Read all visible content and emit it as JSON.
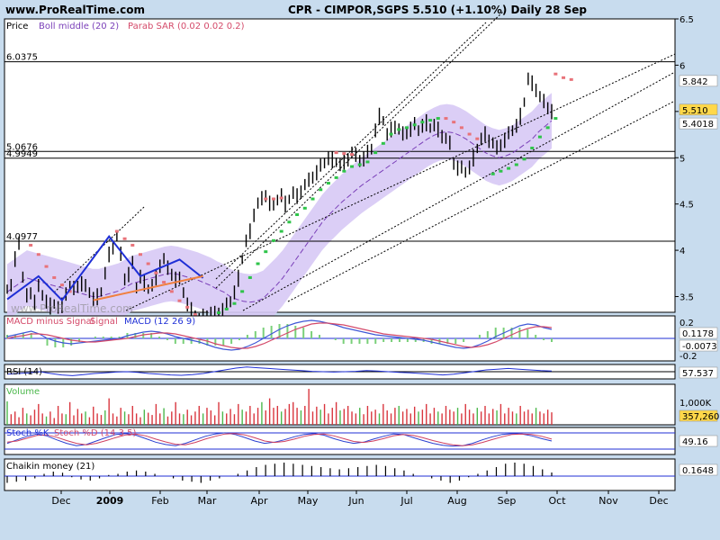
{
  "header": {
    "site": "www.ProRealTime.com",
    "title": "CPR - CIMPOR,SGPS   5.510 (+1.10%)   Daily  28 Sep"
  },
  "watermark": "www.ProRealTime.com",
  "colors": {
    "background": "#c8dcee",
    "panel": "#ffffff",
    "price": "#000000",
    "boll_band": "#d7c9f5",
    "boll_mid": "#7a3fb8",
    "sar_up": "#2fc44a",
    "sar_down": "#e8737a",
    "trend_blue": "#1f2fd6",
    "trend_orange": "#f08040",
    "macd": "#3f58d6",
    "signal": "#d44a6a",
    "volume": "#d9363e",
    "volume_up": "#4cb84c",
    "stoch_k": "#2b3fd0",
    "stoch_d": "#d04060",
    "chaikin": "#000000",
    "hline": "#000000",
    "price_box": "#ffd84a"
  },
  "chart_data": [
    {
      "panel": "price",
      "type": "line",
      "legend": [
        "Price",
        "Boll middle (20 2)",
        "Parab SAR (0.02 0.02 0.2)"
      ],
      "x_labels": [
        "Dec",
        "2009",
        "Feb",
        "Mar",
        "Apr",
        "May",
        "Jun",
        "Jul",
        "Aug",
        "Sep",
        "Oct",
        "Nov",
        "Dec"
      ],
      "y_ticks": [
        3.5,
        4,
        4.5,
        5,
        5.5,
        6,
        6.5
      ],
      "ylim": [
        3.33,
        6.5
      ],
      "h_levels": [
        {
          "value": 6.0375,
          "label": "6.0375"
        },
        {
          "value": 5.0676,
          "label": "5.0676"
        },
        {
          "value": 4.9949,
          "label": "4.9949"
        },
        {
          "value": 4.0977,
          "label": "4.0977"
        }
      ],
      "last_values": {
        "sar": "5.842",
        "price": "5.510",
        "boll_mid": "5.4018"
      },
      "close": [
        3.58,
        3.62,
        3.9,
        4.1,
        3.7,
        3.5,
        3.55,
        3.45,
        3.6,
        3.52,
        3.45,
        3.4,
        3.42,
        3.38,
        3.4,
        3.55,
        3.6,
        3.58,
        3.62,
        3.65,
        3.6,
        3.55,
        3.48,
        3.5,
        3.55,
        3.75,
        3.95,
        4.05,
        4.15,
        3.95,
        3.7,
        3.75,
        3.85,
        3.6,
        3.72,
        3.65,
        3.58,
        3.62,
        3.7,
        3.85,
        3.9,
        3.8,
        3.75,
        3.7,
        3.68,
        3.55,
        3.42,
        3.35,
        3.3,
        3.25,
        3.28,
        3.3,
        3.32,
        3.31,
        3.33,
        3.36,
        3.4,
        3.45,
        3.55,
        3.7,
        3.9,
        4.1,
        4.2,
        4.4,
        4.5,
        4.55,
        4.6,
        4.52,
        4.48,
        4.55,
        4.6,
        4.5,
        4.55,
        4.62,
        4.58,
        4.65,
        4.7,
        4.75,
        4.8,
        4.85,
        4.9,
        4.95,
        5.0,
        4.98,
        4.95,
        4.92,
        4.95,
        5.0,
        5.05,
        5.02,
        4.98,
        5.0,
        5.05,
        5.1,
        5.3,
        5.45,
        5.4,
        5.25,
        5.3,
        5.35,
        5.3,
        5.25,
        5.28,
        5.32,
        5.35,
        5.3,
        5.35,
        5.38,
        5.32,
        5.35,
        5.3,
        5.25,
        5.2,
        5.15,
        4.95,
        4.9,
        4.88,
        4.85,
        4.9,
        5.0,
        5.1,
        5.2,
        5.25,
        5.2,
        5.15,
        5.1,
        5.15,
        5.2,
        5.25,
        5.3,
        5.35,
        5.45,
        5.6,
        5.85,
        5.8,
        5.75,
        5.65,
        5.6,
        5.55,
        5.51
      ],
      "boll_mid": [
        3.55,
        3.6,
        3.65,
        3.7,
        3.68,
        3.66,
        3.64,
        3.62,
        3.6,
        3.58,
        3.56,
        3.54,
        3.52,
        3.5,
        3.5,
        3.52,
        3.54,
        3.56,
        3.6,
        3.64,
        3.66,
        3.68,
        3.7,
        3.72,
        3.74,
        3.75,
        3.74,
        3.72,
        3.7,
        3.68,
        3.65,
        3.62,
        3.58,
        3.55,
        3.5,
        3.47,
        3.45,
        3.44,
        3.45,
        3.48,
        3.55,
        3.62,
        3.7,
        3.8,
        3.9,
        4.0,
        4.1,
        4.2,
        4.3,
        4.38,
        4.45,
        4.52,
        4.58,
        4.64,
        4.7,
        4.75,
        4.8,
        4.85,
        4.9,
        4.95,
        5.0,
        5.05,
        5.1,
        5.15,
        5.2,
        5.24,
        5.27,
        5.28,
        5.27,
        5.24,
        5.2,
        5.15,
        5.1,
        5.05,
        5.02,
        5.0,
        5.02,
        5.05,
        5.1,
        5.15,
        5.2,
        5.28,
        5.34,
        5.4
      ],
      "sar_up": [
        [
          54,
          3.32
        ],
        [
          56,
          3.36
        ],
        [
          58,
          3.42
        ],
        [
          60,
          3.55
        ],
        [
          62,
          3.7
        ],
        [
          64,
          3.85
        ],
        [
          66,
          3.98
        ],
        [
          68,
          4.1
        ],
        [
          70,
          4.2
        ],
        [
          72,
          4.3
        ],
        [
          74,
          4.38
        ],
        [
          76,
          4.45
        ],
        [
          78,
          4.55
        ],
        [
          80,
          4.65
        ],
        [
          82,
          4.72
        ],
        [
          84,
          4.78
        ],
        [
          86,
          4.85
        ],
        [
          88,
          4.9
        ],
        [
          90,
          4.92
        ],
        [
          92,
          4.95
        ],
        [
          94,
          5.05
        ],
        [
          96,
          5.15
        ],
        [
          98,
          5.25
        ],
        [
          100,
          5.3
        ],
        [
          102,
          5.32
        ],
        [
          104,
          5.35
        ],
        [
          106,
          5.38
        ],
        [
          108,
          5.4
        ],
        [
          110,
          5.42
        ],
        [
          124,
          4.82
        ],
        [
          126,
          4.85
        ],
        [
          128,
          4.88
        ],
        [
          130,
          4.92
        ],
        [
          132,
          4.98
        ],
        [
          134,
          5.1
        ],
        [
          136,
          5.22
        ],
        [
          138,
          5.32
        ],
        [
          140,
          5.42
        ]
      ],
      "sar_down": [
        [
          6,
          4.05
        ],
        [
          8,
          3.95
        ],
        [
          10,
          3.82
        ],
        [
          12,
          3.7
        ],
        [
          14,
          3.62
        ],
        [
          16,
          3.55
        ],
        [
          28,
          4.2
        ],
        [
          30,
          4.12
        ],
        [
          32,
          4.05
        ],
        [
          34,
          3.95
        ],
        [
          36,
          3.85
        ],
        [
          38,
          3.75
        ],
        [
          40,
          3.65
        ],
        [
          42,
          3.55
        ],
        [
          44,
          3.45
        ],
        [
          46,
          3.38
        ],
        [
          48,
          3.3
        ],
        [
          66,
          4.55
        ],
        [
          68,
          4.55
        ],
        [
          70,
          4.56
        ],
        [
          84,
          5.05
        ],
        [
          86,
          5.04
        ],
        [
          88,
          5.03
        ],
        [
          112,
          5.42
        ],
        [
          114,
          5.38
        ],
        [
          116,
          5.32
        ],
        [
          118,
          5.25
        ],
        [
          120,
          5.2
        ],
        [
          140,
          5.9
        ],
        [
          142,
          5.86
        ],
        [
          144,
          5.84
        ]
      ],
      "trend_blue": [
        [
          0,
          3.47
        ],
        [
          8,
          3.72
        ],
        [
          14,
          3.46
        ],
        [
          26,
          4.15
        ],
        [
          34,
          3.72
        ],
        [
          44,
          3.9
        ],
        [
          50,
          3.7
        ]
      ],
      "trend_orange": [
        [
          22,
          3.46
        ],
        [
          50,
          3.72
        ]
      ]
    },
    {
      "panel": "macd",
      "type": "line",
      "legend": [
        "MACD minus Signal",
        "Signal",
        "MACD (12 26 9)"
      ],
      "y_ticks": [
        0.2,
        0,
        -0.2
      ],
      "last_values": {
        "macd": "0.1178",
        "signal": "-0.0073"
      },
      "macd": [
        0.02,
        0.04,
        0.06,
        0.08,
        0.05,
        0.0,
        -0.03,
        -0.05,
        -0.06,
        -0.05,
        -0.04,
        -0.03,
        -0.02,
        -0.01,
        0.0,
        0.03,
        0.05,
        0.07,
        0.08,
        0.07,
        0.05,
        0.02,
        0.0,
        -0.02,
        -0.04,
        -0.07,
        -0.1,
        -0.12,
        -0.13,
        -0.12,
        -0.09,
        -0.05,
        0.0,
        0.05,
        0.1,
        0.14,
        0.17,
        0.19,
        0.2,
        0.19,
        0.17,
        0.15,
        0.12,
        0.1,
        0.08,
        0.06,
        0.04,
        0.03,
        0.02,
        0.01,
        0.0,
        -0.01,
        -0.02,
        -0.04,
        -0.06,
        -0.08,
        -0.1,
        -0.11,
        -0.1,
        -0.07,
        -0.03,
        0.02,
        0.06,
        0.1,
        0.14,
        0.16,
        0.15,
        0.12,
        0.1
      ],
      "signal": [
        0.0,
        0.02,
        0.03,
        0.05,
        0.05,
        0.04,
        0.02,
        0.0,
        -0.02,
        -0.03,
        -0.04,
        -0.04,
        -0.03,
        -0.02,
        -0.01,
        0.0,
        0.02,
        0.04,
        0.05,
        0.06,
        0.06,
        0.05,
        0.03,
        0.01,
        -0.01,
        -0.03,
        -0.06,
        -0.08,
        -0.1,
        -0.11,
        -0.11,
        -0.09,
        -0.06,
        -0.02,
        0.02,
        0.06,
        0.1,
        0.13,
        0.16,
        0.17,
        0.17,
        0.16,
        0.15,
        0.13,
        0.11,
        0.09,
        0.07,
        0.05,
        0.04,
        0.03,
        0.02,
        0.01,
        0.0,
        -0.01,
        -0.03,
        -0.05,
        -0.07,
        -0.09,
        -0.1,
        -0.09,
        -0.07,
        -0.04,
        0.0,
        0.04,
        0.08,
        0.11,
        0.13,
        0.13,
        0.12
      ]
    },
    {
      "panel": "rsi",
      "type": "line",
      "legend": [
        "RSI (14)"
      ],
      "last_value": "57.537",
      "values": [
        48,
        50,
        52,
        55,
        50,
        46,
        44,
        47,
        50,
        52,
        54,
        55,
        53,
        50,
        48,
        46,
        45,
        47,
        50,
        55,
        60,
        65,
        68,
        66,
        64,
        62,
        60,
        58,
        56,
        55,
        54,
        55,
        56,
        58,
        57,
        55,
        53,
        52,
        50,
        48,
        46,
        48,
        52,
        56,
        60,
        62,
        64,
        62,
        60,
        58,
        57
      ]
    },
    {
      "panel": "volume",
      "type": "bar",
      "legend": [
        "Volume"
      ],
      "y_ticks": [
        "1,000K"
      ],
      "last_value": "357,260",
      "values": [
        0.62,
        0.28,
        0.35,
        0.2,
        0.45,
        0.3,
        0.25,
        0.4,
        0.55,
        0.3,
        0.22,
        0.35,
        0.18,
        0.5,
        0.3,
        0.28,
        0.6,
        0.25,
        0.42,
        0.3,
        0.35,
        0.2,
        0.48,
        0.3,
        0.26,
        0.38,
        0.7,
        0.3,
        0.22,
        0.45,
        0.35,
        0.28,
        0.5,
        0.3,
        0.2,
        0.4,
        0.32,
        0.26,
        0.55,
        0.3,
        0.44,
        0.22,
        0.35,
        0.6,
        0.3,
        0.28,
        0.4,
        0.25,
        0.35,
        0.5,
        0.3,
        0.45,
        0.38,
        0.25,
        0.6,
        0.35,
        0.3,
        0.42,
        0.28,
        0.55,
        0.4,
        0.35,
        0.5,
        0.3,
        0.45,
        0.6,
        0.38,
        0.7,
        0.45,
        0.5,
        0.35,
        0.42,
        0.55,
        0.6,
        0.45,
        0.38,
        0.5,
        0.95,
        0.35,
        0.48,
        0.4,
        0.55,
        0.3,
        0.45,
        0.6,
        0.38,
        0.42,
        0.5,
        0.35,
        0.3,
        0.45,
        0.28,
        0.5,
        0.35,
        0.4,
        0.3,
        0.55,
        0.38,
        0.3,
        0.45,
        0.5,
        0.35,
        0.42,
        0.3,
        0.48,
        0.35,
        0.4,
        0.55,
        0.3,
        0.45,
        0.35,
        0.3,
        0.5,
        0.4,
        0.35,
        0.45,
        0.3,
        0.55,
        0.4,
        0.3,
        0.45,
        0.35,
        0.5,
        0.3,
        0.42,
        0.38,
        0.55,
        0.3,
        0.45,
        0.35,
        0.3,
        0.5,
        0.35,
        0.4,
        0.3,
        0.45,
        0.35,
        0.3,
        0.4,
        0.33
      ]
    },
    {
      "panel": "stochastic",
      "type": "line",
      "legend": [
        "Stoch %K",
        "Stoch %D (14 3 5)"
      ],
      "last_value": "49.16",
      "k": [
        40,
        55,
        70,
        80,
        72,
        55,
        40,
        30,
        35,
        50,
        65,
        78,
        82,
        75,
        60,
        45,
        35,
        30,
        40,
        55,
        70,
        80,
        85,
        78,
        65,
        50,
        40,
        45,
        55,
        68,
        78,
        82,
        75,
        60,
        48,
        40,
        45,
        58,
        70,
        80,
        78,
        65,
        52,
        40,
        32,
        28,
        30,
        40,
        55,
        68,
        78,
        82,
        80,
        72,
        60,
        50
      ],
      "d": [
        45,
        50,
        62,
        74,
        76,
        66,
        52,
        40,
        34,
        40,
        52,
        65,
        76,
        80,
        72,
        58,
        46,
        36,
        34,
        44,
        58,
        70,
        80,
        82,
        76,
        64,
        50,
        44,
        48,
        58,
        70,
        78,
        80,
        72,
        60,
        48,
        44,
        50,
        60,
        72,
        78,
        74,
        64,
        52,
        42,
        34,
        30,
        34,
        44,
        56,
        68,
        78,
        80,
        78,
        70,
        58
      ]
    },
    {
      "panel": "chaikin",
      "type": "bar",
      "legend": [
        "Chaikin money (21)"
      ],
      "last_value": "0.1648",
      "values": [
        -0.3,
        -0.25,
        -0.2,
        -0.1,
        0.1,
        0.2,
        0.15,
        -0.05,
        -0.15,
        -0.2,
        -0.1,
        0.05,
        0.1,
        0.2,
        0.25,
        0.2,
        0.1,
        0.0,
        -0.1,
        -0.2,
        -0.25,
        -0.3,
        -0.2,
        -0.1,
        0.0,
        0.1,
        0.25,
        0.4,
        0.5,
        0.55,
        0.6,
        0.55,
        0.5,
        0.45,
        0.4,
        0.35,
        0.3,
        0.35,
        0.4,
        0.45,
        0.5,
        0.45,
        0.35,
        0.25,
        0.1,
        0.0,
        -0.1,
        -0.2,
        -0.3,
        -0.2,
        -0.05,
        0.1,
        0.25,
        0.4,
        0.55,
        0.6,
        0.55,
        0.45,
        0.3,
        0.16
      ]
    }
  ],
  "x_axis": {
    "labels": [
      "Dec",
      "2009",
      "Feb",
      "Mar",
      "Apr",
      "May",
      "Jun",
      "Jul",
      "Aug",
      "Sep",
      "Oct",
      "Nov",
      "Dec"
    ]
  }
}
